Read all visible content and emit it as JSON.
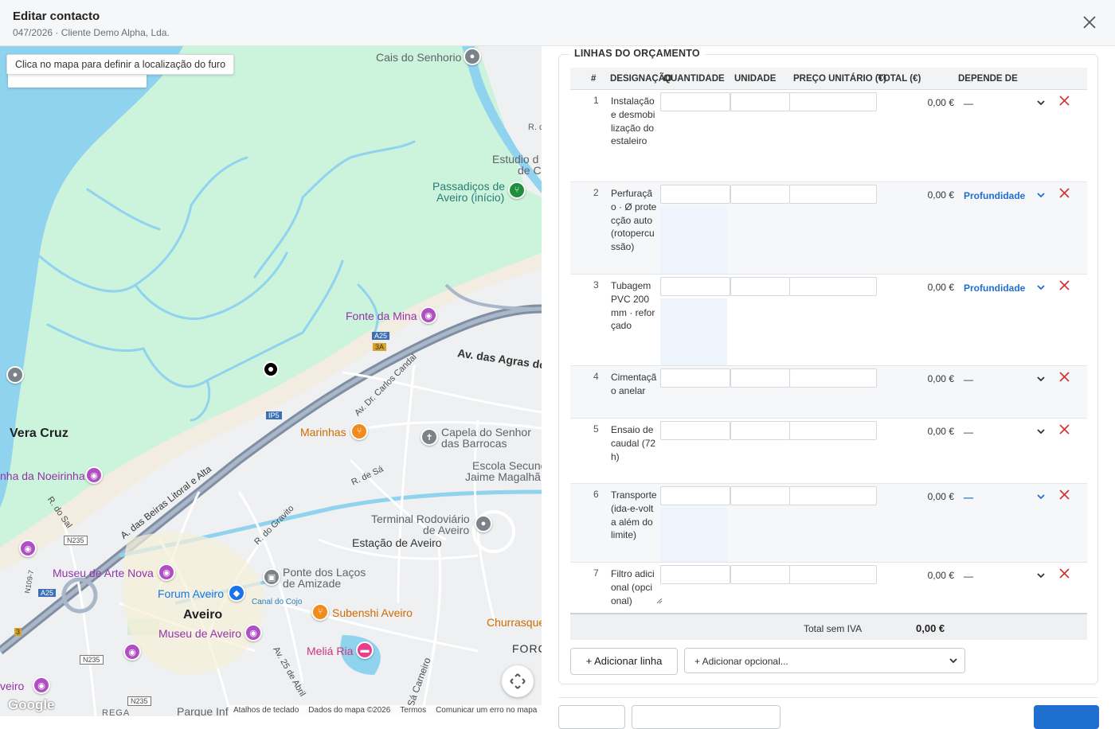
{
  "header": {
    "title": "Editar contacto",
    "subtitle": "047/2026 · Cliente Demo Alpha, Lda."
  },
  "map": {
    "hint": "Clica no mapa para definir a localização do furo",
    "labels": {
      "cais": "Cais do Senhorio",
      "rc": "R. c",
      "estudio1": "Estudio d",
      "estudio2": "de C",
      "passadicos1": "Passadiços de",
      "passadicos2": "Aveiro (início)",
      "fonte": "Fonte da Mina",
      "agras": "Av. das Agras do N",
      "carlos": "Av. Dr. Carlos Candal",
      "vera": "Vera Cruz",
      "marinhas": "Marinhas",
      "capela1": "Capela do Senhor",
      "capela2": "das Barrocas",
      "escola1": "Escola Secund",
      "escola2": "Jaime Magalhã",
      "noeirinha": "nha da Noeirinha",
      "rsa": "R. de Sá",
      "beiras": "A. das Beiras Litoral e Alta",
      "rsal": "R. do Sal",
      "gravito": "R. do Gravito",
      "terminal1": "Terminal Rodoviário",
      "terminal2": "de Aveiro",
      "estacao": "Estação de Aveiro",
      "museu_arte": "Museu de Arte Nova",
      "pontes1": "Ponte dos Laços",
      "pontes2": "de Amizade",
      "forum": "Forum Aveiro",
      "cojo": "Canal do Cojo",
      "aveiro": "Aveiro",
      "subenshi": "Subenshi Aveiro",
      "churrasq": "Churrasque",
      "museu_aveiro": "Museu de Aveiro",
      "melia": "Meliá Ria",
      "forc": "FORC",
      "av25": "Av. 25 de Abril",
      "sacarneiro": "Sá Carneiro",
      "veiro": "veiro",
      "rega": "REGA",
      "parque": "Parque Inf",
      "n235a": "N235",
      "n235b": "N235",
      "n235c": "N235",
      "n109": "N109-7",
      "a25a": "A25",
      "a25b": "A25",
      "a3a": "3A",
      "ip5": "IP5",
      "n3": "3"
    },
    "google": "Google",
    "attribution": [
      "Atalhos de teclado",
      "Dados do mapa ©2026",
      "Termos",
      "Comunicar um erro no mapa"
    ]
  },
  "panel": {
    "legend": "LINHAS DO ORÇAMENTO",
    "columns": {
      "num": "#",
      "designacao": "DESIGNAÇÃO",
      "quantidade": "QUANTIDADE",
      "unidade": "UNIDADE",
      "preco": "PREÇO UNITÁRIO (€)",
      "total": "TOTAL (€)",
      "depende": "DEPENDE DE"
    },
    "rows": [
      {
        "num": "1",
        "designacao": "Instalação e desmobilização do estaleiro",
        "total": "0,00 €",
        "depende": "—"
      },
      {
        "num": "2",
        "designacao": "Perfuração · Ø protecção auto (rotopercussão)",
        "total": "0,00 €",
        "depende": "Profundidade"
      },
      {
        "num": "3",
        "designacao": "Tubagem PVC 200 mm · reforçado",
        "total": "0,00 €",
        "depende": "Profundidade"
      },
      {
        "num": "4",
        "designacao": "Cimentação anelar",
        "total": "0,00 €",
        "depende": "—"
      },
      {
        "num": "5",
        "designacao": "Ensaio de caudal (72 h)",
        "total": "0,00 €",
        "depende": "—"
      },
      {
        "num": "6",
        "designacao": "Transporte (ida-e-volta além do limite)",
        "total": "0,00 €",
        "depende": "—"
      },
      {
        "num": "7",
        "designacao": "Filtro adicional (opcional)",
        "total": "0,00 €",
        "depende": "—"
      }
    ],
    "footer": {
      "label": "Total sem IVA",
      "value": "0,00 €"
    },
    "add_line": "+ Adicionar linha",
    "add_optional": "+ Adicionar opcional..."
  },
  "colors": {
    "accent": "#1f6fd1",
    "delete": "#d32f2f",
    "water": "#8fd3ef",
    "wetland": "#ccf3dc"
  }
}
